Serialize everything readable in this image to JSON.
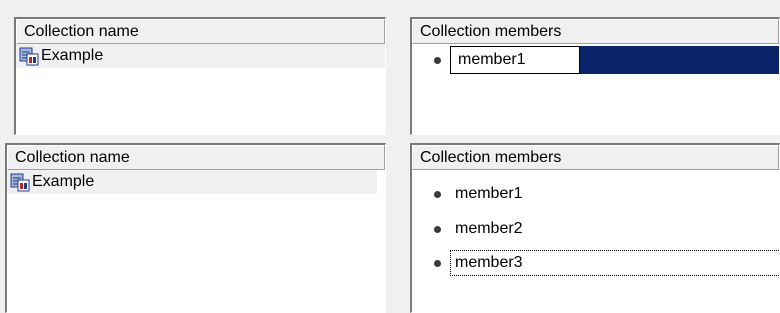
{
  "top_view": {
    "names_panel": {
      "header": "Collection name",
      "items": [
        {
          "label": "Example"
        }
      ]
    },
    "members_panel": {
      "header": "Collection members",
      "edit_value": "member1"
    }
  },
  "bottom_view": {
    "names_panel": {
      "header": "Collection name",
      "items": [
        {
          "label": "Example"
        }
      ]
    },
    "members_panel": {
      "header": "Collection members",
      "items": [
        {
          "label": "member1"
        },
        {
          "label": "member2"
        },
        {
          "label": "member3"
        }
      ],
      "focused_item": "member3"
    }
  },
  "icons": {
    "collection": "collection-icon",
    "member": "bullet-icon"
  },
  "colors": {
    "selection_bg": "#0a246a",
    "panel_bg": "#ffffff",
    "window_bg": "#f0f0f0",
    "bullet": "#3a3a3a"
  }
}
